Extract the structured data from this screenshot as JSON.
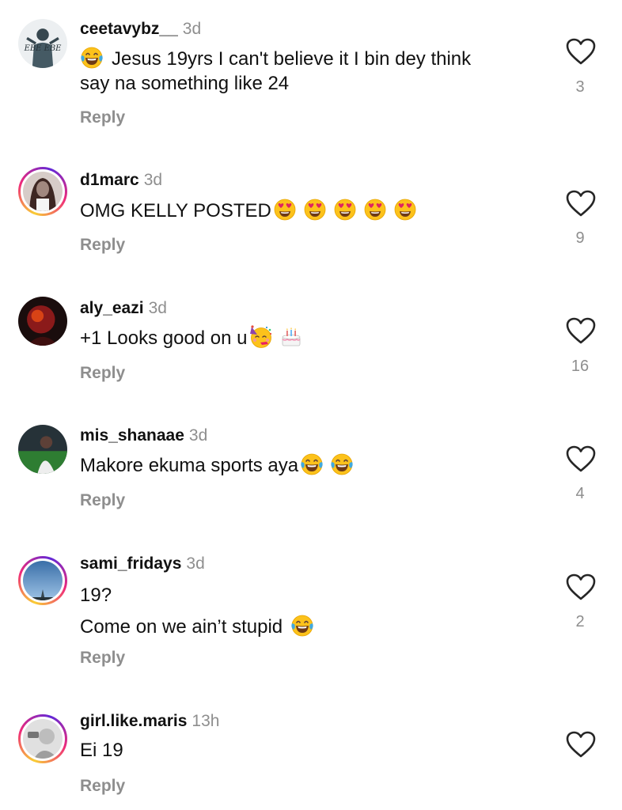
{
  "comments": [
    {
      "username": "ceetavybz__",
      "time": "3d",
      "lines": [
        "😂 Jesus 19yrs I can't believe it I bin dey think",
        "say na something like 24"
      ],
      "reply_label": "Reply",
      "likes": "3",
      "avatar_text": "EBE EBE"
    },
    {
      "username": "d1marc",
      "time": "3d",
      "lines": [
        "OMG KELLY POSTED"
      ],
      "reply_label": "Reply",
      "likes": "9"
    },
    {
      "username": "aly_eazi",
      "time": "3d",
      "lines": [
        "+1 Looks good on u"
      ],
      "reply_label": "Reply",
      "likes": "16"
    },
    {
      "username": "mis_shanaae",
      "time": "3d",
      "lines": [
        "Makore ekuma sports aya"
      ],
      "reply_label": "Reply",
      "likes": "4"
    },
    {
      "username": "sami_fridays",
      "time": "3d",
      "lines": [
        "19?",
        "Come on we ain’t stupid"
      ],
      "reply_label": "Reply",
      "likes": "2"
    },
    {
      "username": "girl.like.maris",
      "time": "13h",
      "lines": [
        "Ei 19"
      ],
      "reply_label": "Reply",
      "likes": ""
    }
  ],
  "icons": {
    "like": "heart-outline-icon",
    "tears_of_joy": "face-with-tears-of-joy-emoji",
    "heart_eyes": "smiling-face-with-heart-eyes-emoji",
    "partying": "partying-face-emoji",
    "cake": "birthday-cake-emoji"
  },
  "colors": {
    "text": "#111111",
    "secondary": "#8e8e8e",
    "story_ring_start": "#f9ce34",
    "story_ring_mid": "#ee2a7b",
    "story_ring_end": "#6228d7"
  }
}
